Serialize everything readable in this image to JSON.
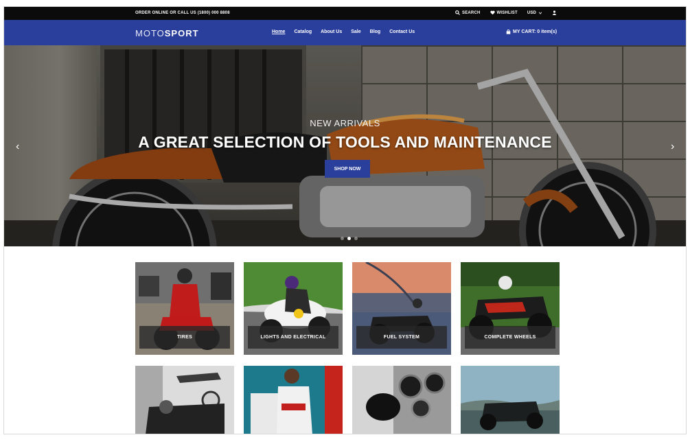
{
  "topbar": {
    "order_text": "ORDER ONLINE OR CALL US (1800) 000 8808",
    "search_label": "SEARCH",
    "wishlist_label": "WISHLIST",
    "currency": "USD"
  },
  "brand": {
    "light": "MOTO",
    "bold": "SPORT"
  },
  "nav": {
    "items": [
      "Home",
      "Catalog",
      "About Us",
      "Sale",
      "Blog",
      "Contact Us"
    ],
    "active": "Home"
  },
  "cart": {
    "label": "MY CART: 0 item(s)"
  },
  "hero": {
    "subtitle": "NEW ARRIVALS",
    "title": "A GREAT SELECTION OF TOOLS AND MAINTENANCE",
    "button_label": "SHOP NOW",
    "slide_count": 3,
    "active_slide": 2
  },
  "categories": [
    {
      "label": "TIRES"
    },
    {
      "label": "LIGHTS AND ELECTRICAL"
    },
    {
      "label": "FUEL SYSTEM"
    },
    {
      "label": "COMPLETE WHEELS"
    }
  ],
  "colors": {
    "topbar": "#0b0b0b",
    "brand_blue": "#2a3e9c",
    "white": "#ffffff"
  }
}
